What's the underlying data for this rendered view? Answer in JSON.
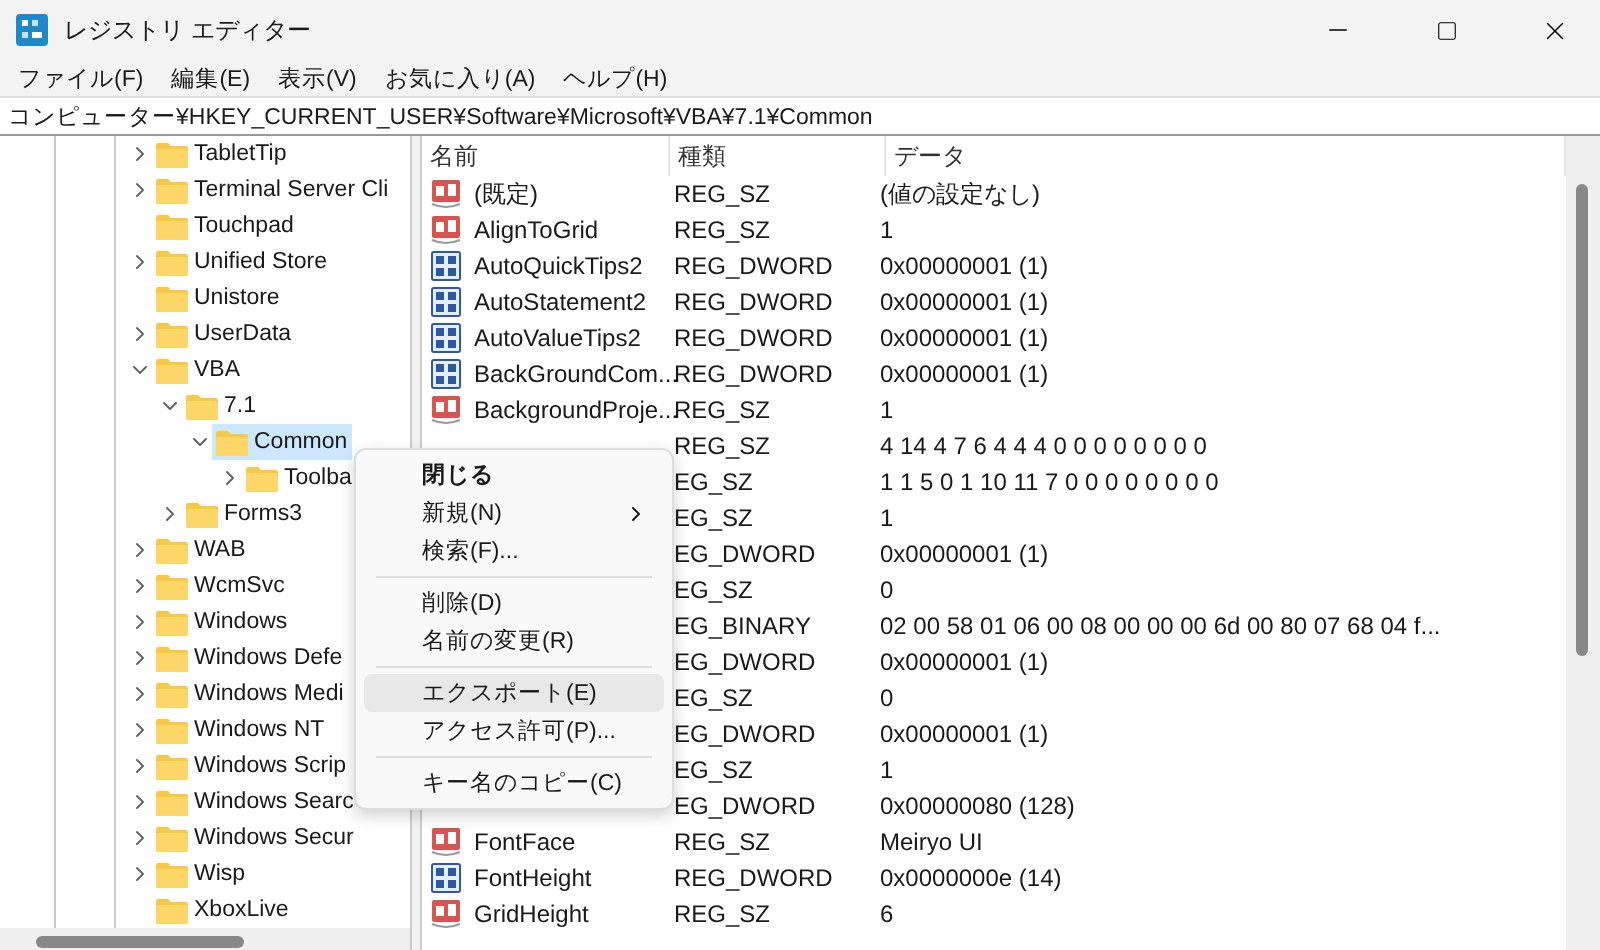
{
  "window": {
    "title": "レジストリ エディター"
  },
  "menu_bar": [
    "ファイル(F)",
    "編集(E)",
    "表示(V)",
    "お気に入り(A)",
    "ヘルプ(H)"
  ],
  "address": "コンピューター¥HKEY_CURRENT_USER¥Software¥Microsoft¥VBA¥7.1¥Common",
  "tree": [
    {
      "label": "TabletTip",
      "expanded": false,
      "selected": false
    },
    {
      "label": "Terminal Server Cli",
      "expanded": false,
      "selected": false
    },
    {
      "label": "Touchpad",
      "selected": false
    },
    {
      "label": "Unified Store",
      "expanded": false,
      "selected": false
    },
    {
      "label": "Unistore",
      "selected": false
    },
    {
      "label": "UserData",
      "expanded": false,
      "selected": false
    },
    {
      "label": "VBA",
      "expanded": true,
      "selected": false,
      "children": [
        {
          "label": "7.1",
          "expanded": true,
          "selected": false,
          "children": [
            {
              "label": "Common",
              "expanded": true,
              "selected": true,
              "children": [
                {
                  "label": "Toolba",
                  "expanded": false,
                  "selected": false
                }
              ]
            }
          ]
        },
        {
          "label": "Forms3",
          "expanded": false,
          "selected": false
        }
      ]
    },
    {
      "label": "WAB",
      "expanded": false,
      "selected": false
    },
    {
      "label": "WcmSvc",
      "expanded": false,
      "selected": false
    },
    {
      "label": "Windows",
      "expanded": false,
      "selected": false
    },
    {
      "label": "Windows Defe",
      "expanded": false,
      "selected": false
    },
    {
      "label": "Windows Medi",
      "expanded": false,
      "selected": false
    },
    {
      "label": "Windows NT",
      "expanded": false,
      "selected": false
    },
    {
      "label": "Windows Scrip",
      "expanded": false,
      "selected": false
    },
    {
      "label": "Windows Searc",
      "expanded": false,
      "selected": false
    },
    {
      "label": "Windows Secur",
      "expanded": false,
      "selected": false
    },
    {
      "label": "Wisp",
      "expanded": false,
      "selected": false
    },
    {
      "label": "XboxLive",
      "selected": false
    }
  ],
  "values": {
    "columns": [
      "名前",
      "種類",
      "データ"
    ],
    "rows": [
      {
        "kind": "string",
        "name": "(既定)",
        "type": "REG_SZ",
        "data": "(値の設定なし)"
      },
      {
        "kind": "string",
        "name": "AlignToGrid",
        "type": "REG_SZ",
        "data": "1"
      },
      {
        "kind": "binary",
        "name": "AutoQuickTips2",
        "type": "REG_DWORD",
        "data": "0x00000001 (1)"
      },
      {
        "kind": "binary",
        "name": "AutoStatement2",
        "type": "REG_DWORD",
        "data": "0x00000001 (1)"
      },
      {
        "kind": "binary",
        "name": "AutoValueTips2",
        "type": "REG_DWORD",
        "data": "0x00000001 (1)"
      },
      {
        "kind": "binary",
        "name": "BackGroundCom...",
        "type": "REG_DWORD",
        "data": "0x00000001 (1)"
      },
      {
        "kind": "string",
        "name": "BackgroundProje...",
        "type": "REG_SZ",
        "data": "1"
      },
      {
        "type": "REG_SZ",
        "data": "4 14 4 7 6 4 4 4 0 0 0 0 0 0 0 0"
      },
      {
        "type": "EG_SZ",
        "data": "1 1 5 0 1 10 11 7 0 0 0 0 0 0 0 0"
      },
      {
        "type": "EG_SZ",
        "data": "1"
      },
      {
        "type": "EG_DWORD",
        "data": "0x00000001 (1)"
      },
      {
        "type": "EG_SZ",
        "data": "0"
      },
      {
        "type": "EG_BINARY",
        "data": "02 00 58 01 06 00 08 00 00 00 6d 00 80 07 68 04 f..."
      },
      {
        "type": "EG_DWORD",
        "data": "0x00000001 (1)"
      },
      {
        "type": "EG_SZ",
        "data": "0"
      },
      {
        "type": "EG_DWORD",
        "data": "0x00000001 (1)"
      },
      {
        "type": "EG_SZ",
        "data": "1"
      },
      {
        "type": "EG_DWORD",
        "data": "0x00000080 (128)"
      },
      {
        "kind": "string",
        "name": "FontFace",
        "type": "REG_SZ",
        "data": "Meiryo UI"
      },
      {
        "kind": "binary",
        "name": "FontHeight",
        "type": "REG_DWORD",
        "data": "0x0000000e (14)"
      },
      {
        "kind": "string",
        "name": "GridHeight",
        "type": "REG_SZ",
        "data": "6"
      }
    ]
  },
  "context_menu": {
    "items": [
      {
        "kind": "item",
        "label": "閉じる",
        "bold": true,
        "submenu": false,
        "selected": false
      },
      {
        "kind": "item",
        "label": "新規(N)",
        "bold": false,
        "submenu": true,
        "selected": false
      },
      {
        "kind": "item",
        "label": "検索(F)...",
        "bold": false,
        "submenu": false,
        "selected": false
      },
      {
        "kind": "separator"
      },
      {
        "kind": "item",
        "label": "削除(D)",
        "bold": false,
        "submenu": false,
        "selected": false
      },
      {
        "kind": "item",
        "label": "名前の変更(R)",
        "bold": false,
        "submenu": false,
        "selected": false
      },
      {
        "kind": "separator"
      },
      {
        "kind": "item",
        "label": "エクスポート(E)",
        "bold": false,
        "submenu": false,
        "selected": true
      },
      {
        "kind": "item",
        "label": "アクセス許可(P)...",
        "bold": false,
        "submenu": false,
        "selected": false
      },
      {
        "kind": "separator"
      },
      {
        "kind": "item",
        "label": "キー名のコピー(C)",
        "bold": false,
        "submenu": false,
        "selected": false
      }
    ]
  }
}
